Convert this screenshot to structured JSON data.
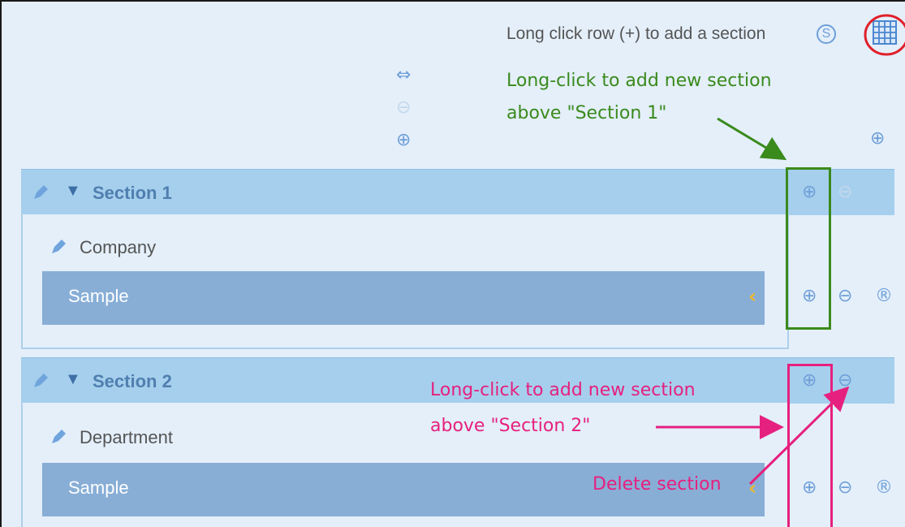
{
  "toolbar": {
    "hint_text": "Long click row (+) to add a section",
    "s_icon_glyph": "S"
  },
  "top_controls": {
    "swap_glyph": "⇔",
    "remove_glyph": "⊖",
    "add_glyph": "⊕",
    "right_add_glyph": "⊕"
  },
  "sections": [
    {
      "title": "Section 1",
      "field_label": "Company",
      "field_value": "Sample",
      "chevron": "‹",
      "header_add_glyph": "⊕",
      "header_remove_glyph": "⊖",
      "row_add_glyph": "⊕",
      "row_remove_glyph": "⊖",
      "row_r_glyph": "®"
    },
    {
      "title": "Section 2",
      "field_label": "Department",
      "field_value": "Sample",
      "chevron": "‹",
      "header_add_glyph": "⊕",
      "header_remove_glyph": "⊖",
      "row_add_glyph": "⊕",
      "row_remove_glyph": "⊖",
      "row_r_glyph": "®"
    }
  ],
  "annotations": {
    "green_line1": "Long-click to add new section",
    "green_line2": "above \"Section 1\"",
    "pink_line1": "Long-click to add new section",
    "pink_line2": "above \"Section 2\"",
    "pink_delete": "Delete section",
    "green_color": "#3a8a1c",
    "pink_color": "#e6207e",
    "red_color": "#e0202a"
  },
  "colors": {
    "background": "#e4effa",
    "section_header": "#a6cfed",
    "input_bar": "#88aed6",
    "accent_icon": "#6f9fd8"
  }
}
